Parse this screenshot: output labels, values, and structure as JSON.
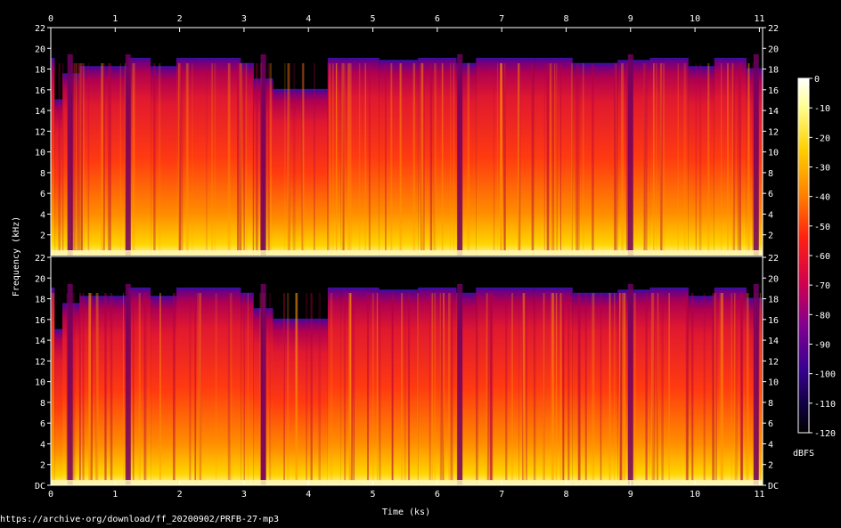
{
  "chart_data": {
    "type": "heatmap",
    "xlabel": "Time (ks)",
    "ylabel": "Frequency (kHz)",
    "x_ticks": [
      "0",
      "1",
      "2",
      "3",
      "4",
      "5",
      "6",
      "7",
      "8",
      "9",
      "10",
      "11"
    ],
    "xlim": [
      0,
      11.05
    ],
    "channels": [
      {
        "y_ticks": [
          "2",
          "4",
          "6",
          "8",
          "10",
          "12",
          "14",
          "16",
          "18",
          "20",
          "22"
        ],
        "ylim": [
          0,
          22
        ]
      },
      {
        "y_ticks": [
          "DC",
          "2",
          "4",
          "6",
          "8",
          "10",
          "12",
          "14",
          "16",
          "18",
          "20",
          "22"
        ],
        "ylim": [
          0,
          22
        ]
      }
    ],
    "colorbar": {
      "label": "dBFS",
      "ticks": [
        "0",
        "-10",
        "-20",
        "-30",
        "-40",
        "-50",
        "-60",
        "-70",
        "-80",
        "-90",
        "-100",
        "-110",
        "-120"
      ],
      "range": [
        -120,
        0
      ]
    },
    "cutoff_segments_khz": [
      [
        0.0,
        0.06,
        19.0
      ],
      [
        0.06,
        0.18,
        15.0
      ],
      [
        0.18,
        0.45,
        17.5
      ],
      [
        0.45,
        1.2,
        18.2
      ],
      [
        1.2,
        1.55,
        19.0
      ],
      [
        1.55,
        1.95,
        18.2
      ],
      [
        1.95,
        2.95,
        19.0
      ],
      [
        2.95,
        3.15,
        18.5
      ],
      [
        3.15,
        3.45,
        17.0
      ],
      [
        3.45,
        4.3,
        16.0
      ],
      [
        4.3,
        4.5,
        19.0
      ],
      [
        4.5,
        5.1,
        19.0
      ],
      [
        5.1,
        5.7,
        18.8
      ],
      [
        5.7,
        6.3,
        19.0
      ],
      [
        6.3,
        6.6,
        18.5
      ],
      [
        6.6,
        7.5,
        19.0
      ],
      [
        7.5,
        8.1,
        19.0
      ],
      [
        8.1,
        8.8,
        18.5
      ],
      [
        8.8,
        9.3,
        18.8
      ],
      [
        9.3,
        9.9,
        19.0
      ],
      [
        9.9,
        10.3,
        18.2
      ],
      [
        10.3,
        10.8,
        19.0
      ],
      [
        10.8,
        11.05,
        18.0
      ]
    ],
    "quiet_gaps_ks": [
      0.3,
      1.2,
      3.3,
      6.35,
      9.0,
      10.95
    ]
  },
  "source_url": "https://archive·org/download/ff_20200902/PRFB-27·mp3"
}
